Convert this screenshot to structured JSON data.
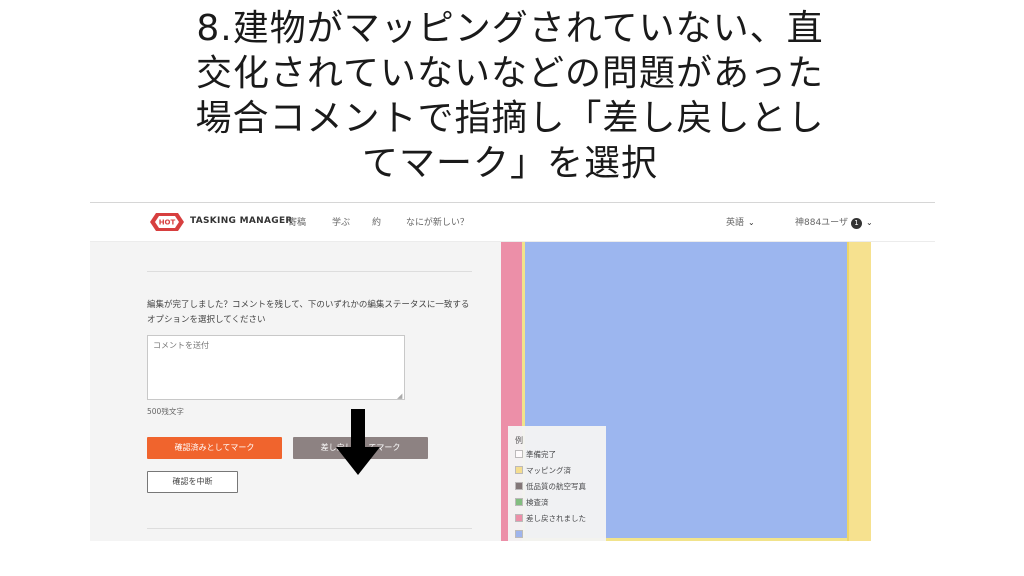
{
  "slide": {
    "title_lines": [
      "8.建物がマッピングされていない、直",
      "交化されていないなどの問題があった",
      "場合コメントで指摘し「差し戻しとし",
      "てマーク」を選択"
    ]
  },
  "navbar": {
    "logo_badge": "HOT",
    "app_name": "TASKING MANAGER",
    "items": [
      "寄稿",
      "学ぶ",
      "約",
      "なにが新しい？"
    ],
    "language": "英語",
    "user": "神884ユーザ",
    "notification_count": "1"
  },
  "task": {
    "instruction": "編集が完了しました？コメントを残して、下のいずれかの編集ステータスに一致するオプションを選択してください",
    "comment_placeholder": "コメントを送付",
    "char_count": "500残文字",
    "complete_label": "確認済みとしてマーク",
    "invalidate_label": "差し戻しとしてマーク",
    "stop_label": "確認を中断"
  },
  "legend": {
    "title": "例",
    "items": [
      {
        "label": "準備完了",
        "color": "#ffffff"
      },
      {
        "label": "マッピング済",
        "color": "#f6e18f"
      },
      {
        "label": "低品質の航空写真",
        "color": "#7f7777"
      },
      {
        "label": "検査済",
        "color": "#7fbf7f"
      },
      {
        "label": "差し戻されました",
        "color": "#ec8fa8"
      }
    ]
  },
  "colors": {
    "complete_button": "#f0642d",
    "invalidate_button": "#8d8282",
    "map_blue": "#9cb6ef",
    "map_pink": "#ec8fa8",
    "map_yellow": "#f6e18f"
  }
}
